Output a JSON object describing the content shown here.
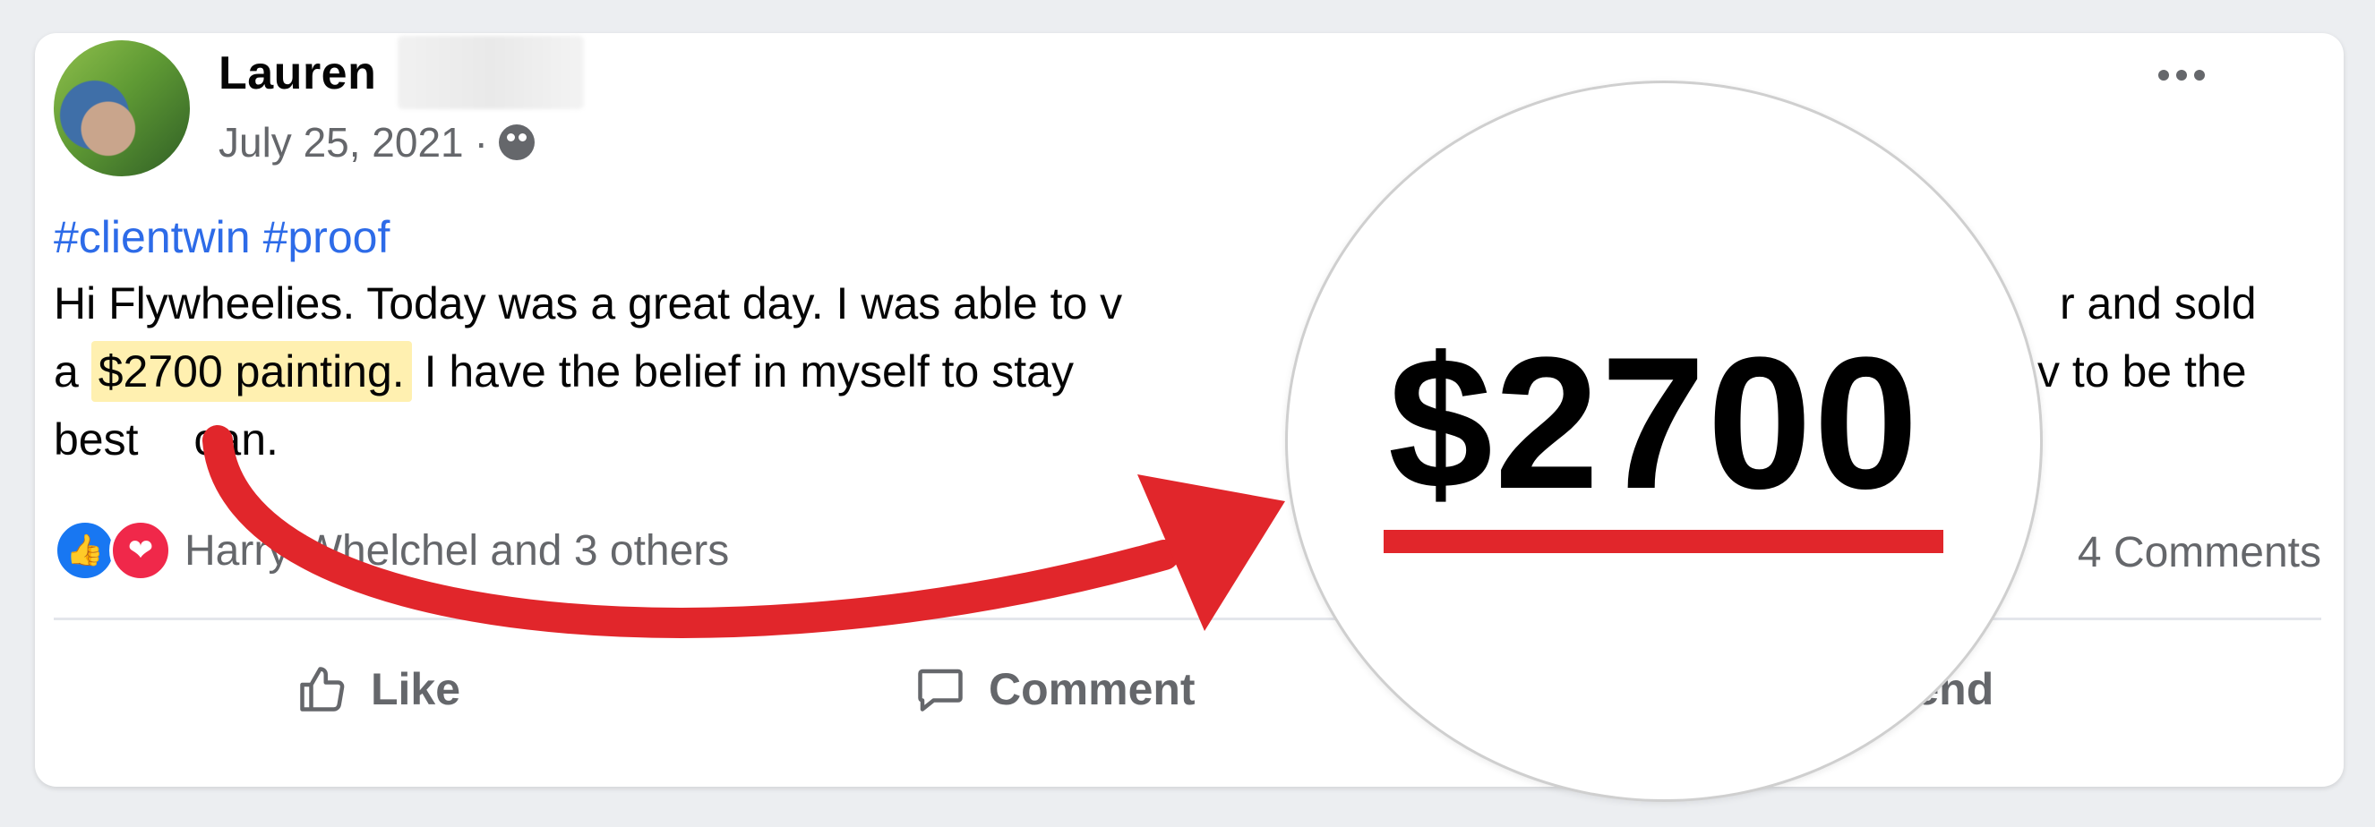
{
  "post": {
    "author_first_name": "Lauren",
    "date": "July 25, 2021",
    "separator": "·",
    "visibility_icon": "globe-icon",
    "more_icon": "more-options-icon",
    "hashtags": [
      "#clientwin",
      "#proof"
    ],
    "body": {
      "line1": "Hi Flywheelies. Today was a great day. I was able to v",
      "line1_end": "r and sold",
      "line2_start": "a",
      "highlight": "$2700 painting.",
      "line2_mid": "I have the belief in myself to stay",
      "line2_end": "v to be the",
      "line3_start": "best",
      "line3_end": "can."
    },
    "reactions": {
      "icons": [
        "like-reaction-icon",
        "love-reaction-icon"
      ],
      "text": "Harry Whelchel and 3 others"
    },
    "comments_count_text": "4 Comments",
    "actions": {
      "like": "Like",
      "comment": "Comment",
      "send": "Send"
    }
  },
  "overlay": {
    "magnified_value": "$2700",
    "accent_color": "#e1262b"
  },
  "colors": {
    "hashtag": "#2d6be8",
    "highlight": "#fff0b0",
    "like_blue": "#1877f2",
    "love_red": "#f0284a"
  }
}
